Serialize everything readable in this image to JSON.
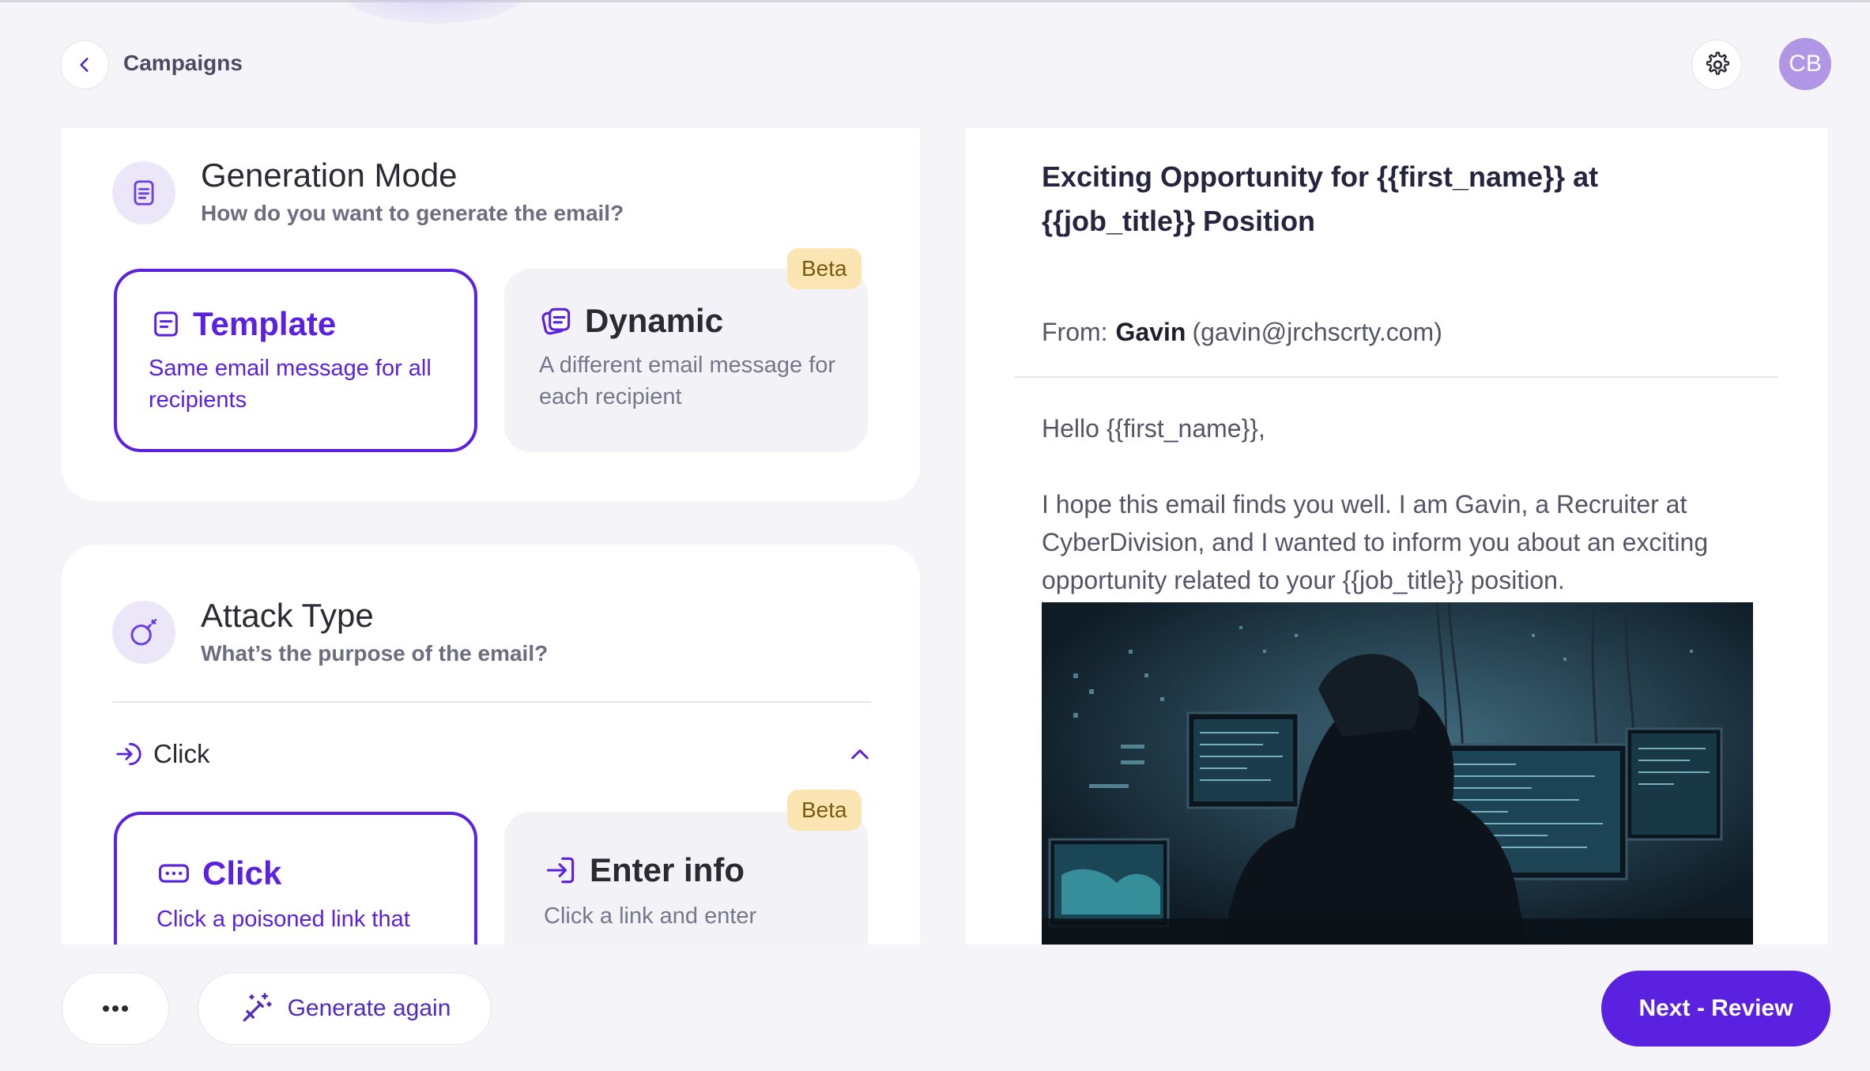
{
  "header": {
    "breadcrumb": "Campaigns",
    "avatar_initials": "CB"
  },
  "generation_mode": {
    "title": "Generation Mode",
    "subtitle": "How do you want to generate the email?",
    "options": [
      {
        "title": "Template",
        "description": "Same email message for all recipients",
        "selected": true
      },
      {
        "title": "Dynamic",
        "description": "A different email message for each recipient",
        "badge": "Beta",
        "selected": false
      }
    ]
  },
  "attack_type": {
    "title": "Attack Type",
    "subtitle": "What’s the purpose of the email?",
    "current": "Click",
    "options": [
      {
        "title": "Click",
        "description": "Click a poisoned link that",
        "selected": true
      },
      {
        "title": "Enter info",
        "description": "Click a link and enter",
        "badge": "Beta",
        "selected": false
      }
    ]
  },
  "preview": {
    "subject": "Exciting Opportunity for {{first_name}} at {{job_title}} Position",
    "from_label": "From:",
    "from_name": "Gavin",
    "from_email": "(gavin@jrchscrty.com)",
    "greeting": "Hello {{first_name}},",
    "body": "I hope this email finds you well. I am Gavin, a Recruiter at CyberDivision, and I wanted to inform you about an exciting opportunity related to your {{job_title}} position."
  },
  "footer": {
    "regenerate_label": "Generate again",
    "next_label": "Next - Review"
  },
  "colors": {
    "accent": "#5b21e0",
    "avatar": "#b196e6",
    "beta_bg": "#fbe6b3"
  }
}
